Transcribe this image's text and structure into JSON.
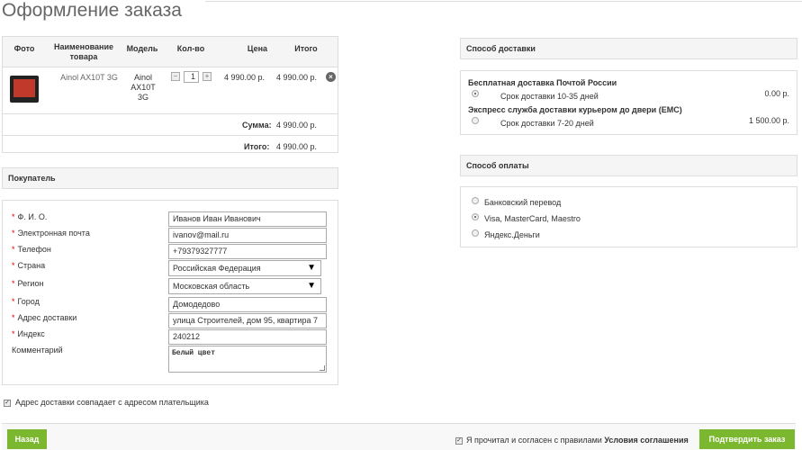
{
  "page": {
    "title": "Оформление заказа"
  },
  "cart": {
    "headers": {
      "photo": "Фото",
      "name": "Наименование товара",
      "model": "Модель",
      "qty": "Кол-во",
      "price": "Цена",
      "total": "Итого"
    },
    "item": {
      "name": "Ainol AX10T 3G",
      "model": "Ainol AX10T 3G",
      "qty": "1",
      "price": "4 990.00 р.",
      "total": "4 990.00 р.",
      "qty_minus": "−",
      "qty_plus": "+",
      "remove": "×"
    },
    "sum_label": "Сумма:",
    "sum_value": "4 990.00 р.",
    "total_label": "Итого:",
    "total_value": "4 990.00 р."
  },
  "buyer": {
    "heading": "Покупатель",
    "fields": {
      "name": {
        "label": "Ф. И. О.",
        "value": "Иванов Иван Иванович",
        "required": "*"
      },
      "email": {
        "label": "Электронная почта",
        "value": "ivanov@mail.ru",
        "required": "*"
      },
      "phone": {
        "label": "Телефон",
        "value": "+79379327777",
        "required": "*"
      },
      "country": {
        "label": "Страна",
        "value": "Российская Федерация",
        "required": "*"
      },
      "region": {
        "label": "Регион",
        "value": "Московская область",
        "required": "*"
      },
      "city": {
        "label": "Город",
        "value": "Домодедово",
        "required": "*"
      },
      "address": {
        "label": "Адрес доставки",
        "value": "улица Строителей, дом 95, квартира 7",
        "required": "*"
      },
      "zip": {
        "label": "Индекс",
        "value": "240212",
        "required": "*"
      },
      "comment": {
        "label": "Комментарий",
        "value": "Белый цвет"
      }
    },
    "same_address": "Адрес доставки совпадает с адресом плательщика"
  },
  "delivery": {
    "heading": "Способ доставки",
    "options": [
      {
        "title": "Бесплатная доставка Почтой России",
        "term": "Срок доставки 10-35 дней",
        "price": "0.00 р."
      },
      {
        "title": "Экспресс служба доставки курьером до двери (EMC)",
        "term": "Срок доставки 7-20 дней",
        "price": "1 500.00 р."
      }
    ]
  },
  "payment": {
    "heading": "Способ оплаты",
    "options": [
      "Банковский перевод",
      "Visa, MasterCard, Maestro",
      "Яндекс.Деньги"
    ]
  },
  "footer": {
    "back": "Назад",
    "agree_text": "Я прочитал и согласен с правилами",
    "agree_link": "Условия соглашения",
    "confirm": "Подтвердить заказ"
  },
  "colors": {
    "accent": "#7cb82f",
    "required": "#dd0000"
  }
}
